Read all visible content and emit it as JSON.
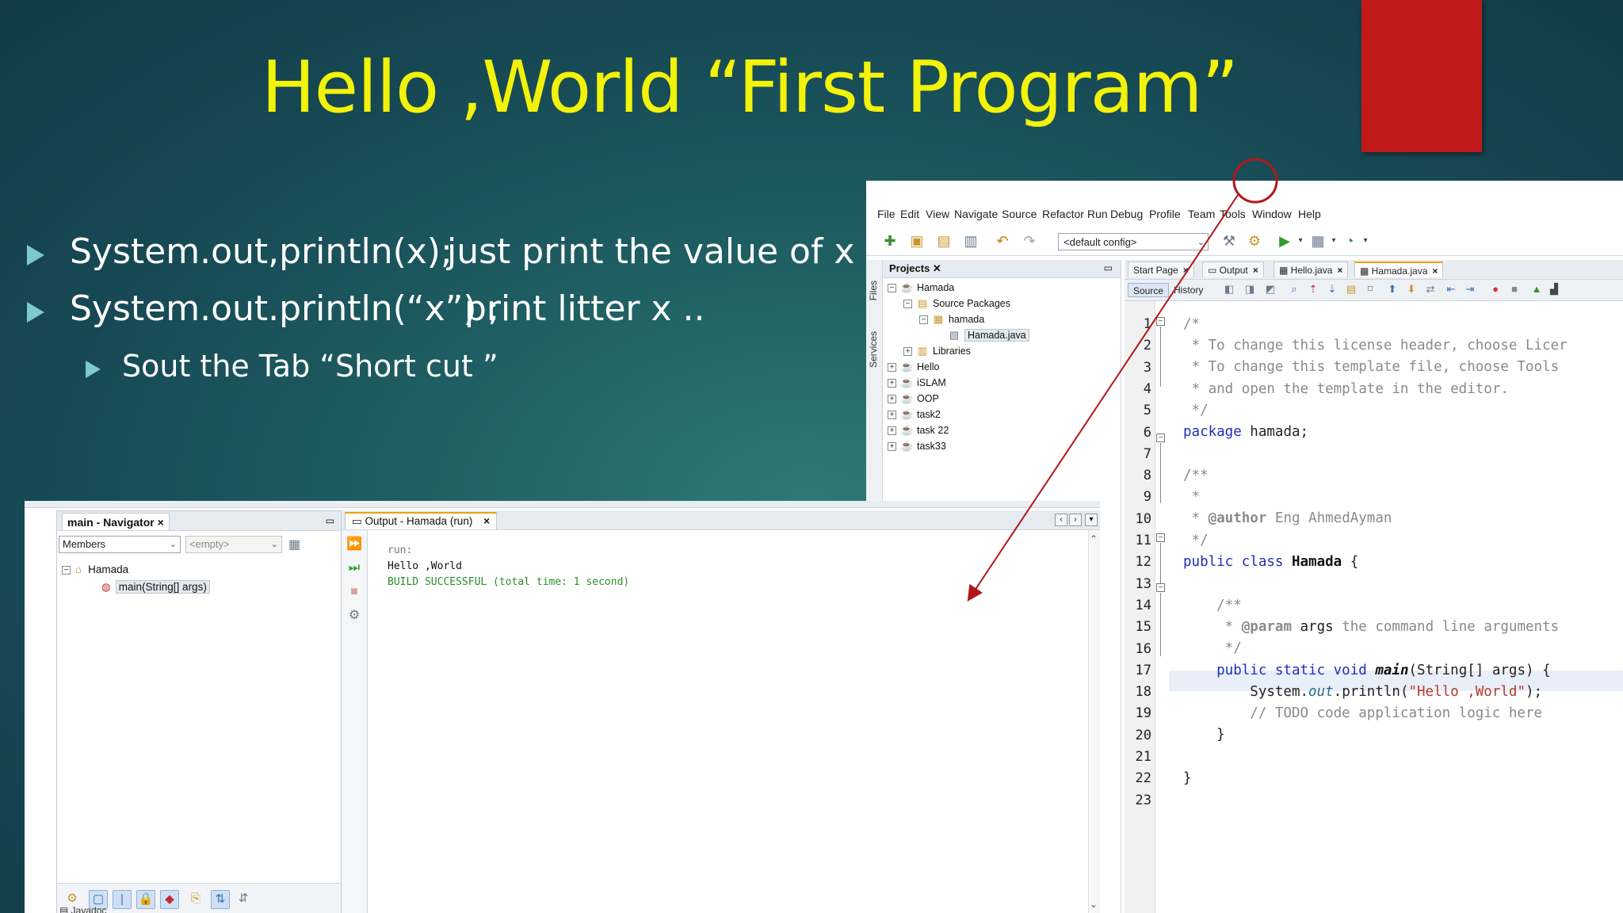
{
  "slide": {
    "title": "Hello ,World  “First Program”",
    "bullets": [
      {
        "code": "System.out,println(x);",
        "desc": "just print the value of x  .."
      },
      {
        "code": "System.out.println(“x”) ;",
        "desc": "print litter x .."
      }
    ],
    "sub_bullet": "Sout   the Tab “Short cut ”"
  },
  "ide": {
    "menu": [
      "File",
      "Edit",
      "View",
      "Navigate",
      "Source",
      "Refactor",
      "Run",
      "Debug",
      "Profile",
      "Team",
      "Tools",
      "Window",
      "Help"
    ],
    "config": "<default config>",
    "side_labels": [
      "Files",
      "Services"
    ],
    "projects": {
      "title": "Projects",
      "tree": [
        {
          "label": "Hamada",
          "icon": "project-icon",
          "expander": "⊟"
        },
        {
          "label": "Source Packages",
          "icon": "folder-icon",
          "expander": "⊟"
        },
        {
          "label": "hamada",
          "icon": "package-icon",
          "expander": "⊟"
        },
        {
          "label": "Hamada.java",
          "icon": "java-file-icon",
          "expander": ""
        },
        {
          "label": "Libraries",
          "icon": "library-icon",
          "expander": "⊞"
        },
        {
          "label": "Hello",
          "icon": "project-icon",
          "expander": "⊞"
        },
        {
          "label": "iSLAM",
          "icon": "project-icon",
          "expander": "⊞"
        },
        {
          "label": "OOP",
          "icon": "project-icon",
          "expander": "⊞"
        },
        {
          "label": "task2",
          "icon": "project-icon",
          "expander": "⊞"
        },
        {
          "label": "task 22",
          "icon": "project-icon",
          "expander": "⊞"
        },
        {
          "label": "task33",
          "icon": "project-icon",
          "expander": "⊞"
        }
      ]
    },
    "editor_tabs": [
      "Start Page",
      "Output",
      "Hello.java",
      "Hamada.java"
    ],
    "source_label": "Source",
    "history_label": "History",
    "code": {
      "line_numbers": [
        "1",
        "2",
        "3",
        "4",
        "5",
        "6",
        "7",
        "8",
        "9",
        "10",
        "11",
        "12",
        "13",
        "14",
        "15",
        "16",
        "17",
        "18",
        "19",
        "20",
        "21",
        "22",
        "23"
      ],
      "l1": "/*",
      "l2": " * To change this license header, choose Licer",
      "l3": " * To change this template file, choose Tools",
      "l4": " * and open the template in the editor.",
      "l5": " */",
      "l6_kw": "package",
      "l6_rest": " hamada;",
      "l8": "/**",
      "l9": " *",
      "l10_a": " * ",
      "l10_tag": "@author",
      "l10_b": " Eng AhmedAyman",
      "l11": " */",
      "l12_kw": "public class",
      "l12_name": "Hamada",
      "l12_rest": " {",
      "l14": "    /**",
      "l15_a": "     * ",
      "l15_tag": "@param",
      "l15_arg": " args",
      "l15_b": " the command line arguments",
      "l16": "     */",
      "l17_kw": "    public static void",
      "l17_name": "main",
      "l17_rest": "(String[] args) {",
      "l18_a": "        System.",
      "l18_out": "out",
      "l18_b": ".println(",
      "l18_str": "\"Hello ,World\"",
      "l18_c": ");",
      "l19": "        // TODO code application logic here",
      "l20": "    }",
      "l22": "}"
    },
    "navigator": {
      "title": "main - Navigator",
      "members_label": "Members",
      "filter_placeholder": "<empty>",
      "root": "Hamada",
      "method": "main(String[] args)"
    },
    "output": {
      "tab_title": "Output - Hamada (run)",
      "lines": [
        "run:",
        "Hello ,World",
        "BUILD SUCCESSFUL (total time: 1 second)"
      ]
    },
    "bottom_cutoff": "Javadoc"
  },
  "colors": {
    "title": "#f2f20a",
    "accent_red": "#c01919",
    "bullet_marker": "#7ec8d0",
    "annotation": "#b01818",
    "build_success": "#2e8b2e"
  }
}
